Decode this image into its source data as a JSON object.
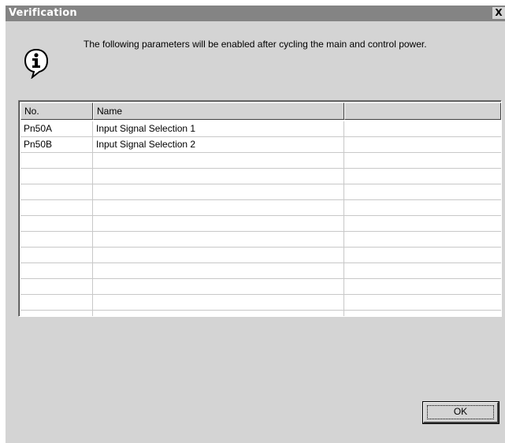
{
  "window": {
    "title": "Verification",
    "close_label": "X"
  },
  "icon": "info-speech-bubble-icon",
  "message": "The following parameters will be enabled after cycling the main and control power.",
  "table": {
    "columns": [
      "No.",
      "Name",
      ""
    ],
    "rows": [
      [
        "Pn50A",
        "Input Signal Selection 1",
        ""
      ],
      [
        "Pn50B",
        "Input Signal Selection 2",
        ""
      ],
      [
        "",
        "",
        ""
      ],
      [
        "",
        "",
        ""
      ],
      [
        "",
        "",
        ""
      ],
      [
        "",
        "",
        ""
      ],
      [
        "",
        "",
        ""
      ],
      [
        "",
        "",
        ""
      ],
      [
        "",
        "",
        ""
      ],
      [
        "",
        "",
        ""
      ],
      [
        "",
        "",
        ""
      ],
      [
        "",
        "",
        ""
      ],
      [
        "",
        "",
        ""
      ]
    ]
  },
  "buttons": {
    "ok_label": "OK"
  },
  "colors": {
    "titlebar": "#848484",
    "dialog_bg": "#d4d4d4",
    "table_bg": "#ffffff"
  }
}
